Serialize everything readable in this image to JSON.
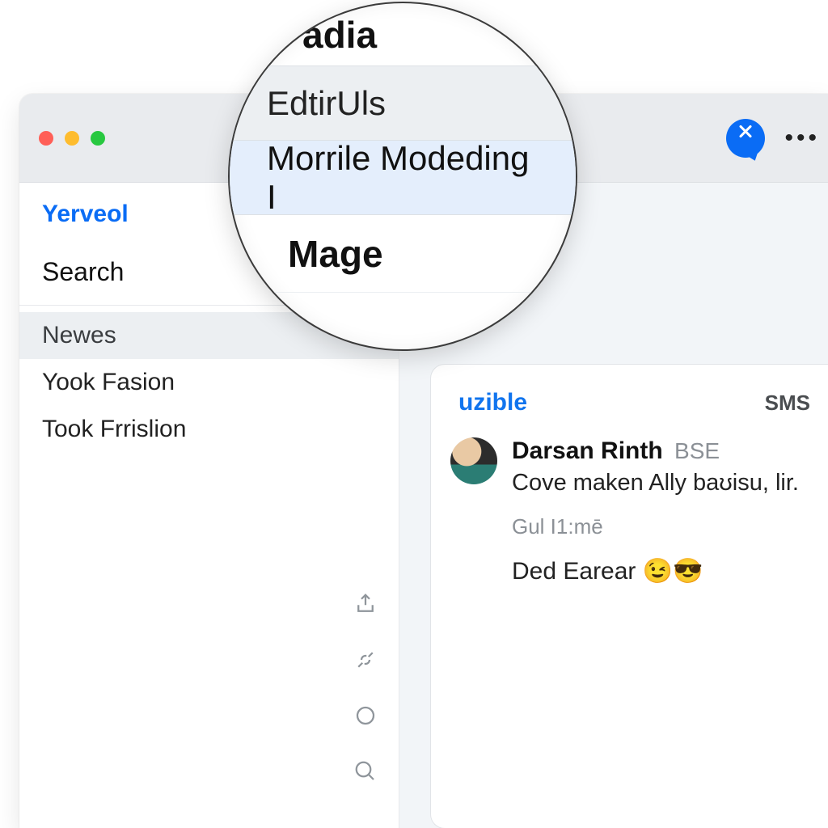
{
  "sidebar": {
    "app_name": "Yerveol",
    "search_label": "Search",
    "items": [
      {
        "label": "Newes"
      },
      {
        "label": "Yook Fasion"
      },
      {
        "label": "Took Frrislion"
      }
    ]
  },
  "main_panel": {
    "panel_link": "uzible",
    "sms_label": "SMS",
    "message": {
      "name": "Darsan Rinth",
      "suffix": "BSE",
      "body": "Cove maken Ally baʊisu, lir.",
      "time": "Gul I1:mē",
      "second_line": "Ded Earear 😉😎"
    }
  },
  "magnifier": {
    "row_top": "adia",
    "row_header": "EdtirUls",
    "row_selected": "Morrile Modeding I",
    "row_footer": "Mage"
  },
  "titlebar": {
    "more": "•••"
  }
}
